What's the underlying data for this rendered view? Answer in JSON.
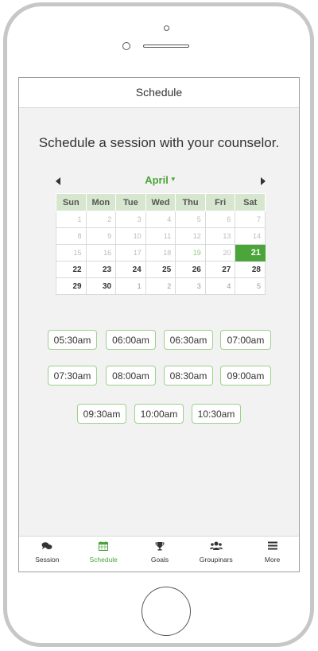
{
  "app": {
    "title": "Schedule"
  },
  "headline": "Schedule a session with your counselor.",
  "calendar": {
    "month": "April",
    "weekdays": [
      "Sun",
      "Mon",
      "Tue",
      "Wed",
      "Thu",
      "Fri",
      "Sat"
    ],
    "weeks": [
      [
        "1",
        "2",
        "3",
        "4",
        "5",
        "6",
        "7"
      ],
      [
        "8",
        "9",
        "10",
        "11",
        "12",
        "13",
        "14"
      ],
      [
        "15",
        "16",
        "17",
        "18",
        "19",
        "20",
        "21"
      ],
      [
        "22",
        "23",
        "24",
        "25",
        "26",
        "27",
        "28"
      ],
      [
        "29",
        "30",
        "1",
        "2",
        "3",
        "4",
        "5"
      ]
    ],
    "selected_day": "21"
  },
  "time_slots": [
    "05:30am",
    "06:00am",
    "06:30am",
    "07:00am",
    "07:30am",
    "08:00am",
    "08:30am",
    "09:00am",
    "09:30am",
    "10:00am",
    "10:30am"
  ],
  "tabs": [
    {
      "label": "Session",
      "icon": "chat-bubbles-icon"
    },
    {
      "label": "Schedule",
      "icon": "calendar-icon",
      "active": true
    },
    {
      "label": "Goals",
      "icon": "trophy-icon"
    },
    {
      "label": "Groupinars",
      "icon": "group-icon"
    },
    {
      "label": "More",
      "icon": "menu-icon"
    }
  ],
  "colors": {
    "accent": "#4ba53a",
    "header_row": "#d6e6cf",
    "slot_border": "#9bd18c"
  }
}
